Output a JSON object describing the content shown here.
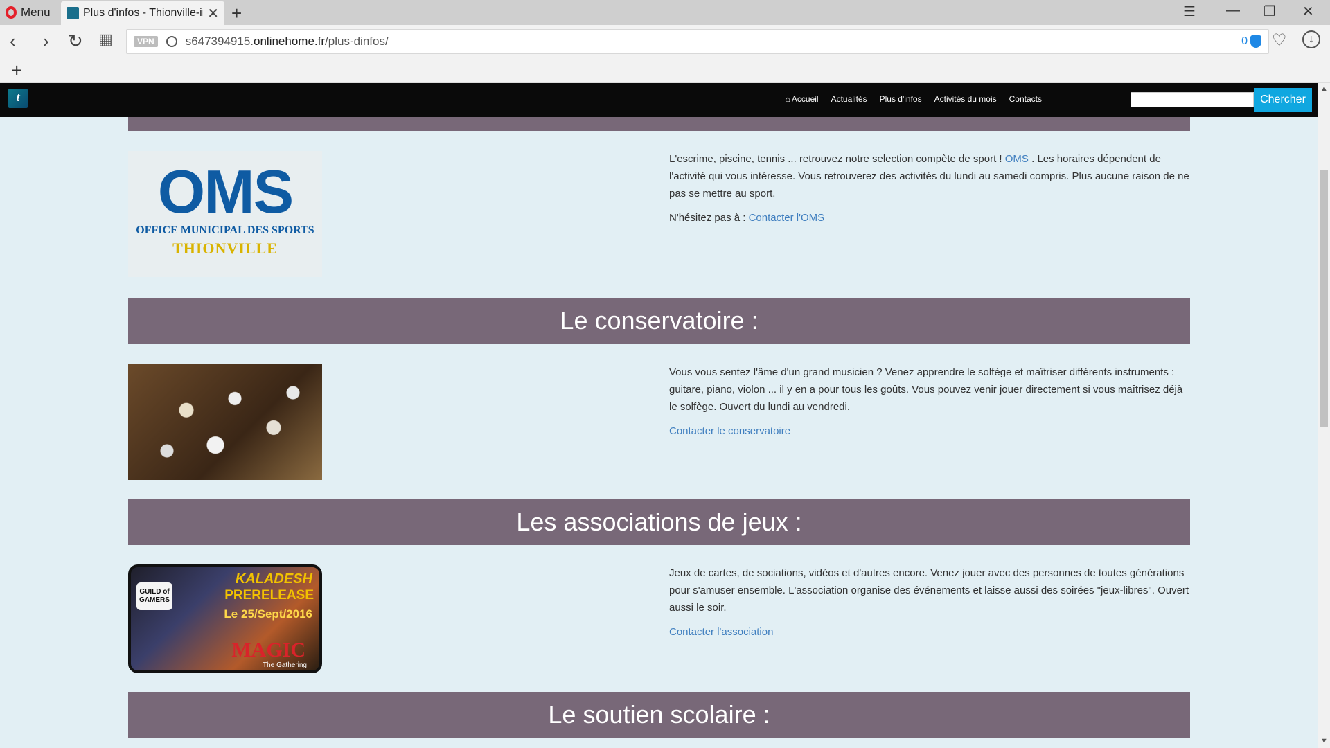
{
  "browser": {
    "menu_label": "Menu",
    "tab_title": "Plus d'infos - Thionville-inf",
    "url_host": "s647394915.",
    "url_domain": "onlinehome.fr",
    "url_path": "/plus-dinfos/",
    "vpn_label": "VPN",
    "adblock_count": "0"
  },
  "site_nav": {
    "links": [
      "Accueil",
      "Actualités",
      "Plus d'infos",
      "Activités du mois",
      "Contacts"
    ],
    "search_placeholder": "",
    "search_button": "Chercher"
  },
  "sections": {
    "oms": {
      "logo_mark": "OMS",
      "logo_line1": "OFFICE MUNICIPAL DES SPORTS",
      "logo_line2": "THIONVILLE",
      "text_before_link": "L'escrime, piscine, tennis ... retrouvez notre selection compète de sport !",
      "link": "OMS",
      "text_after_link": ". Les horaires dépendent de l'activité qui vous intéresse. Vous retrouverez des activités du lundi au samedi compris. Plus aucune raison de ne pas se mettre au sport.",
      "contact_prefix": "N'hésitez pas à :",
      "contact_link": "Contacter l'OMS"
    },
    "conservatoire": {
      "title": "Le conservatoire :",
      "text": "Vous vous sentez l'âme d'un grand musicien ? Venez apprendre le solfège et maîtriser différents instruments : guitare, piano, violon ... il y en a pour tous les goûts. Vous pouvez venir jouer directement si vous maîtrisez déjà le solfège. Ouvert du lundi au vendredi.",
      "contact_link": "Contacter le conservatoire"
    },
    "jeux": {
      "title": "Les associations de jeux :",
      "image_text": [
        "KALADESH",
        "PRERELEASE",
        "Le 25/Sept/2016",
        "MAGIC",
        "The Gathering",
        "GUILD of GAMERS"
      ],
      "text": "Jeux de cartes, de sociations, vidéos et d'autres encore. Venez jouer avec des personnes de toutes générations pour s'amuser ensemble. L'association organise des événements et laisse aussi des soirées \"jeux-libres\". Ouvert aussi le soir.",
      "contact_link": "Contacter l'association"
    },
    "soutien": {
      "title": "Le soutien scolaire :"
    }
  },
  "colors": {
    "banner": "#786878",
    "page_bg": "#e2eff4",
    "link": "#3f7ebf",
    "search_button": "#10a7e0"
  }
}
